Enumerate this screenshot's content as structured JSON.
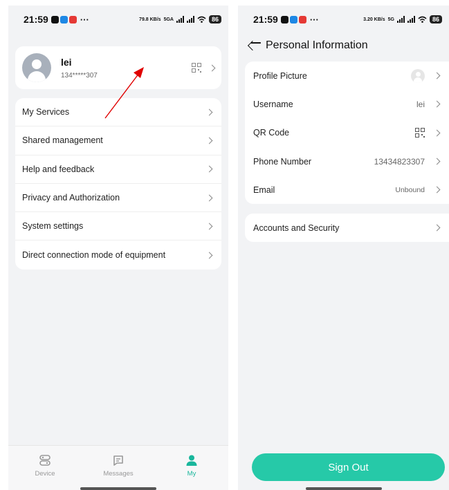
{
  "screenA": {
    "status": {
      "time": "21:59",
      "net_speed": "79.8 KB/s",
      "net_type": "5GA",
      "battery": "86"
    },
    "profile": {
      "name": "lei",
      "phone": "134*****307"
    },
    "menu": [
      {
        "label": "My Services"
      },
      {
        "label": "Shared management"
      },
      {
        "label": "Help and feedback"
      },
      {
        "label": "Privacy and Authorization"
      },
      {
        "label": "System settings"
      },
      {
        "label": "Direct connection mode of equipment"
      }
    ],
    "tabs": [
      {
        "label": "Device",
        "icon": "device-icon"
      },
      {
        "label": "Messages",
        "icon": "messages-icon"
      },
      {
        "label": "My",
        "icon": "person-icon"
      }
    ]
  },
  "screenB": {
    "status": {
      "time": "21:59",
      "net_speed": "3.20 KB/s",
      "net_type": "5G",
      "battery": "86"
    },
    "title": "Personal Information",
    "rows": {
      "profile_picture": "Profile Picture",
      "username_label": "Username",
      "username_value": "lei",
      "qr_label": "QR Code",
      "phone_label": "Phone Number",
      "phone_value": "13434823307",
      "email_label": "Email",
      "email_value": "Unbound"
    },
    "security": "Accounts and Security",
    "sign_out": "Sign Out"
  },
  "colors": {
    "accent": "#19b69c",
    "button": "#26c9a8",
    "annotation_arrow": "#e00000"
  }
}
